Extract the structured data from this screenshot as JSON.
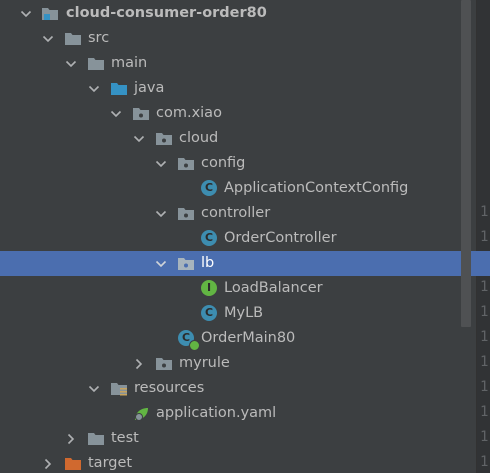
{
  "tree": {
    "project": "cloud-consumer-order80",
    "src": "src",
    "main": "main",
    "java": "java",
    "package_root": "com.xiao",
    "cloud": "cloud",
    "config": "config",
    "config_class": "ApplicationContextConfig",
    "controller": "controller",
    "controller_class": "OrderController",
    "lb": "lb",
    "lb_interface": "LoadBalancer",
    "lb_class": "MyLB",
    "main_class": "OrderMain80",
    "myrule": "myrule",
    "resources": "resources",
    "yaml": "application.yaml",
    "test": "test",
    "target": "target"
  },
  "icons": {
    "class_badge": "C",
    "interface_badge": "I"
  },
  "gutter_numbers": [
    "1",
    "1",
    "1",
    "1",
    "1",
    "1",
    "1",
    "1",
    "1",
    "1"
  ],
  "colors": {
    "background": "#3c3f41",
    "selection": "#4b6eaf",
    "text": "#bbbbbb",
    "target_text": "#c8a45e",
    "class_icon": "#3d8db0",
    "interface_icon": "#62b543"
  }
}
